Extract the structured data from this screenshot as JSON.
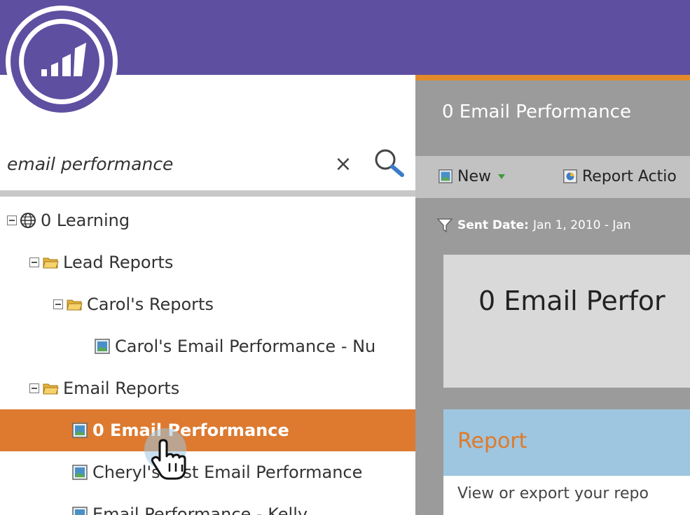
{
  "search": {
    "value": "email performance",
    "clear_label": "×"
  },
  "tree": [
    {
      "label": "0 Learning",
      "type": "workspace",
      "expanded": true,
      "indent": 0
    },
    {
      "label": "Lead Reports",
      "type": "folder",
      "expanded": true,
      "indent": 1
    },
    {
      "label": "Carol's Reports",
      "type": "folder",
      "expanded": true,
      "indent": 2
    },
    {
      "label": "Carol's Email Performance - Nu",
      "type": "report",
      "indent": 3
    },
    {
      "label": "Email Reports",
      "type": "folder",
      "expanded": true,
      "indent": 1
    },
    {
      "label": "0 Email Performance",
      "type": "report",
      "indent": 2,
      "selected": true
    },
    {
      "label": "Cheryl's Test Email Performance",
      "type": "report",
      "indent": 2
    },
    {
      "label": "Email Performance - Kelly",
      "type": "report",
      "indent": 2
    }
  ],
  "main": {
    "title": "0 Email Performance",
    "toolbar": {
      "new_label": "New",
      "actions_label": "Report Actio"
    },
    "filter": {
      "label": "Sent Date:",
      "value": "Jan 1, 2010 - Jan"
    },
    "preview_title": "0 Email Perfor",
    "report_panel": {
      "title": "Report",
      "description": "View or export your repo"
    }
  },
  "colors": {
    "header": "#5f4fa1",
    "selected_row": "#dd7a30",
    "main_bg": "#9b9b9b",
    "accent": "#e28a2b",
    "report_header": "#9ec6e0"
  },
  "icons": {
    "logo": "marketo-logo",
    "workspace": "globe-icon",
    "folder": "folder-icon",
    "report": "report-icon",
    "search": "search-icon",
    "filter": "filter-icon",
    "cursor": "hand-cursor-icon"
  }
}
